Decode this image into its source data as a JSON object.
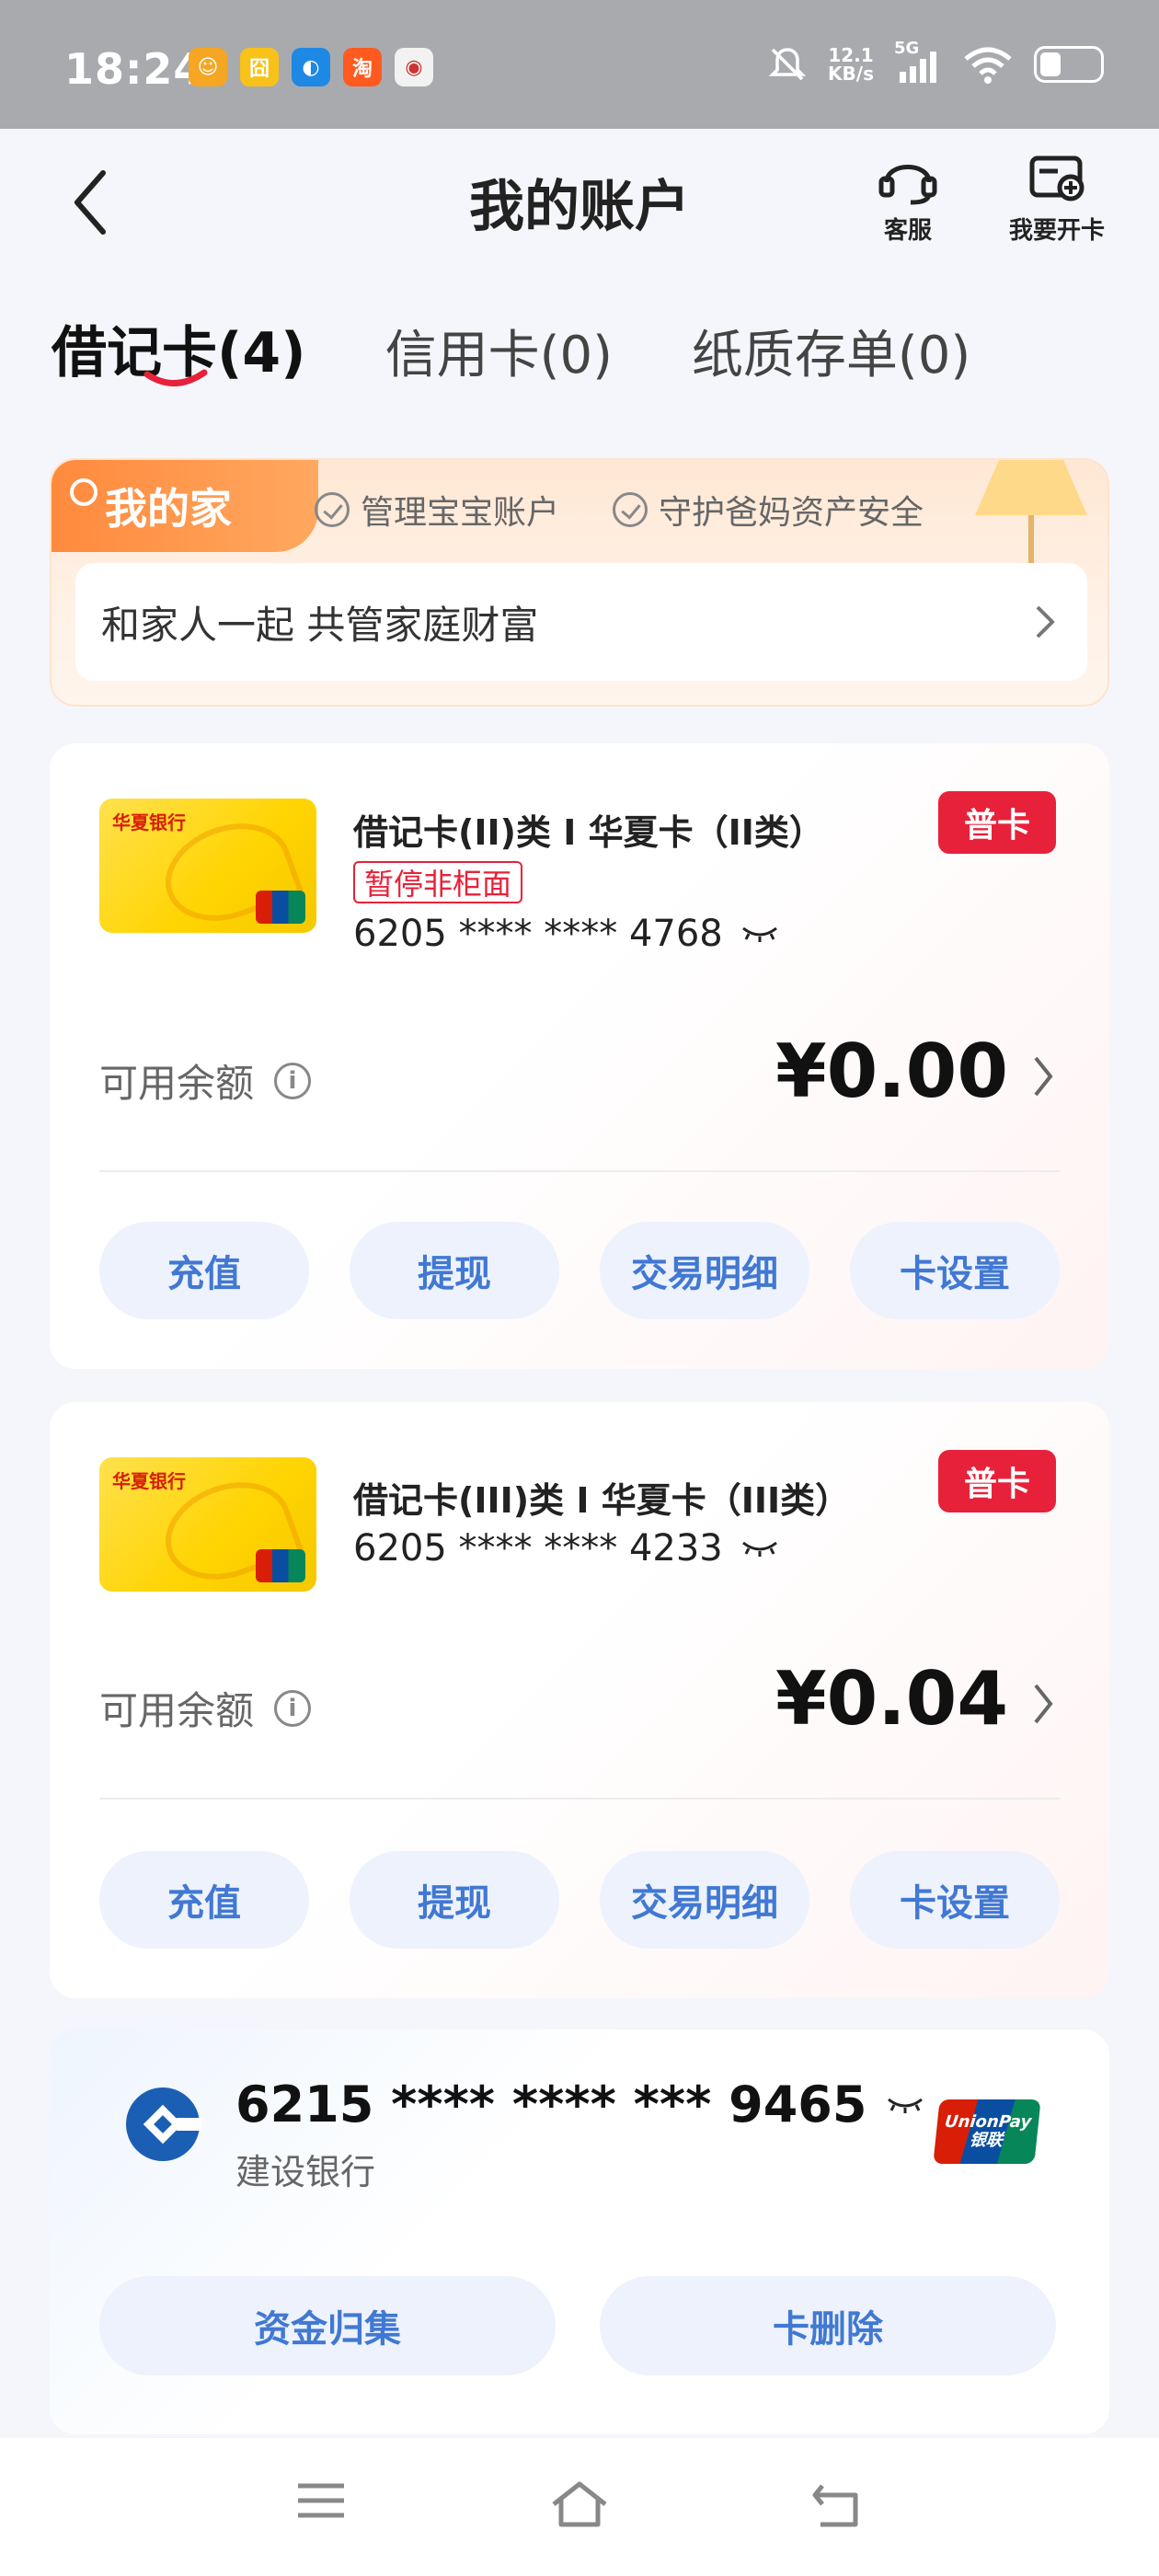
{
  "status_bar": {
    "time": "18:24",
    "apps": [
      {
        "icon": "accessibility-icon",
        "color": "#f5a623",
        "glyph": "☺"
      },
      {
        "icon": "app-icon",
        "color": "#f8c21a",
        "glyph": "囧"
      },
      {
        "icon": "browser-icon",
        "color": "#1e88e5",
        "glyph": "◐"
      },
      {
        "icon": "taobao-icon",
        "color": "#ff5a1f",
        "glyph": "淘"
      },
      {
        "icon": "news-icon",
        "color": "#f2f2f2",
        "glyph": "◉"
      }
    ],
    "network_speed": "12.1",
    "network_unit": "KB/s",
    "signal_label": "5G"
  },
  "header": {
    "title": "我的账户",
    "service_label": "客服",
    "open_card_label": "我要开卡"
  },
  "tabs": [
    {
      "label": "借记卡(4)",
      "active": true
    },
    {
      "label": "信用卡(0)",
      "active": false
    },
    {
      "label": "纸质存单(0)",
      "active": false
    }
  ],
  "family": {
    "badge": "我的家",
    "tag1": "管理宝宝账户",
    "tag2": "守护爸妈资产安全",
    "row_text": "和家人一起 共管家庭财富"
  },
  "cards": [
    {
      "name": "借记卡(II)类 I 华夏卡（II类）",
      "badge": "普卡",
      "status": "暂停非柜面",
      "number": "6205 **** **** 4768",
      "balance_label": "可用余额",
      "balance": "¥0.00",
      "bank_logo_text": "华夏银行",
      "actions": [
        "充值",
        "提现",
        "交易明细",
        "卡设置"
      ]
    },
    {
      "name": "借记卡(III)类 I 华夏卡（III类）",
      "badge": "普卡",
      "number": "6205 **** **** 4233",
      "balance_label": "可用余额",
      "balance": "¥0.04",
      "bank_logo_text": "华夏银行",
      "actions": [
        "充值",
        "提现",
        "交易明细",
        "卡设置"
      ]
    }
  ],
  "ccb_card": {
    "number": "6215 **** **** *** 9465",
    "bank": "建设银行",
    "unionpay_line1": "UnionPay",
    "unionpay_line2": "银联",
    "actions": [
      "资金归集",
      "卡删除"
    ]
  },
  "colors": {
    "accent_blue": "#4178d3",
    "badge_red": "#e8213a",
    "family_orange": "#ff8a3d"
  }
}
